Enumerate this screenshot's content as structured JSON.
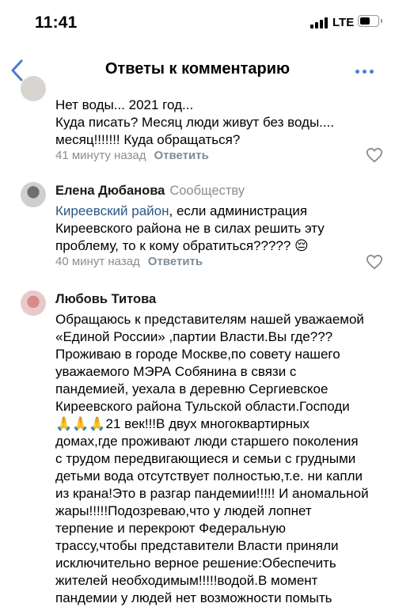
{
  "status_bar": {
    "time": "11:41",
    "network": "LTE",
    "battery_level": 0.55
  },
  "nav": {
    "title": "Ответы к комментарию",
    "back_icon": "chevron-left-icon",
    "more_icon": "more-dots-icon"
  },
  "colors": {
    "accent": "#4d7bd1",
    "link": "#2a5885",
    "secondary_text": "#8a8d91"
  },
  "comments": [
    {
      "text": "Нет воды... 2021 год...\nКуда писать? Месяц люди живут без воды....\nмесяц!!!!!!! Куда обращаться?",
      "time": "41 минуту назад",
      "reply": "Ответить"
    },
    {
      "author": "Елена Дюбанова",
      "tag": "Сообществу",
      "link": "Киреевский район",
      "text": ", если администрация\nКиреевского района не в силах решить эту\nпроблему, то к кому обратиться????? 😔",
      "time": "40 минут назад",
      "reply": "Ответить"
    },
    {
      "author": "Любовь Титова",
      "text": "Обращаюсь к представителям нашей уважаемой\n«Единой России» ,партии Власти.Вы где???\nПроживаю в городе Москве,по совету нашего\nуважаемого МЭРА Собянина  в связи с\nпандемией, уехала в деревню Сергиевское\nКиреевского района Тульской области.Господи\n🙏🙏🙏21 век!!!В  двух многоквартирных\nдомах,где проживают люди старшего поколения\nс трудом передвигающиеся и семьи с грудными\nдетьми вода отсутствует полностью,т.е. ни капли\nиз крана!Это в разгар пандемии!!!!! И аномальной\nжары!!!!!Подозреваю,что у людей лопнет\nтерпение и перекроют Федеральную\nтрассу,чтобы представители Власти приняли\nисключительно верное решение:Обеспечить\nжителей  необходимым!!!!!водой.В  момент\nпандемии у людей нет возможности помыть"
    }
  ]
}
